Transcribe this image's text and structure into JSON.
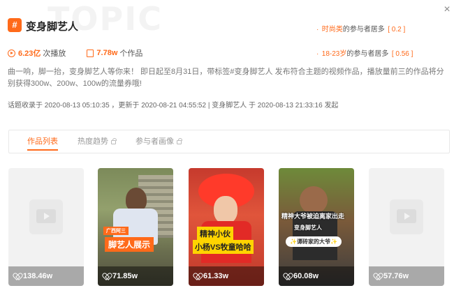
{
  "header": {
    "watermark": "TOPIC",
    "icon_glyph": "#",
    "title": "变身脚艺人",
    "close_glyph": "×"
  },
  "audience": {
    "row1": {
      "highlight": "时尚类",
      "text": "的参与者居多",
      "bracket": "[ 0.2 ]"
    },
    "row2": {
      "highlight": "18-23岁",
      "text": "的参与者居多",
      "bracket": "[ 0.56 ]"
    }
  },
  "stats": {
    "plays_value": "6.23亿",
    "plays_label": "次播放",
    "works_value": "7.78w",
    "works_label": "个作品"
  },
  "description": "曲一响，脚一抬，变身脚艺人等你来！ 即日起至8月31日，带标签#变身脚艺人 发布符合主题的视频作品，播放量前三的作品将分别获得300w、200w、100w的流量券哦!",
  "meta": {
    "included_label": "话题收录于",
    "included_time": "2020-08-13 05:10:35",
    "updated_label": "，更新于",
    "updated_time": "2020-08-21 04:55:52",
    "separator": "|",
    "creator": "变身脚艺人",
    "created_label": "于",
    "created_time": "2020-08-13 21:33:16",
    "created_suffix": "发起"
  },
  "tabs": [
    {
      "label": "作品列表",
      "active": true,
      "locked": false
    },
    {
      "label": "热度趋势",
      "active": false,
      "locked": true
    },
    {
      "label": "参与者画像",
      "active": false,
      "locked": true
    }
  ],
  "cards": [
    {
      "likes": "138.46w",
      "type": "placeholder"
    },
    {
      "likes": "71.85w",
      "type": "video",
      "sticker_a": "广西阿三",
      "sticker_b": "脚艺人展示"
    },
    {
      "likes": "61.33w",
      "type": "video",
      "sticker_a": "精神小伙",
      "sticker_b": "小杨VS牧童哈哈"
    },
    {
      "likes": "60.08w",
      "type": "video",
      "sticker_a": "精神大爷被迫离家出走",
      "sticker_b": "变身脚艺人",
      "sticker_c": "✨谭砖家的大爷✨"
    },
    {
      "likes": "57.76w",
      "type": "placeholder"
    }
  ],
  "colors": {
    "accent": "#ff6a1a"
  }
}
